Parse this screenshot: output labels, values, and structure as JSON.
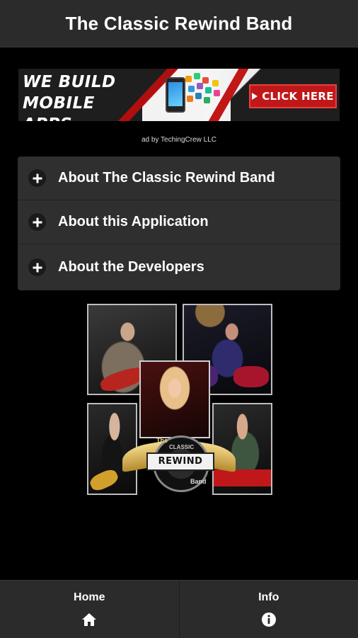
{
  "header": {
    "title": "The Classic Rewind Band"
  },
  "ad": {
    "headline_line1": "WE BUILD MOBILE",
    "headline_line2": "APPS.",
    "cta_label": "CLICK HERE",
    "credit": "ad by TechingCrew LLC"
  },
  "accordion": {
    "items": [
      {
        "label": "About The Classic Rewind Band",
        "icon": "plus-icon"
      },
      {
        "label": "About this Application",
        "icon": "plus-icon"
      },
      {
        "label": "About the Developers",
        "icon": "plus-icon"
      }
    ]
  },
  "collage": {
    "logo_the": "The",
    "logo_classic": "CLASSIC",
    "logo_word": "REWIND",
    "logo_band": "Band"
  },
  "footer": {
    "tabs": [
      {
        "label": "Home",
        "icon": "home-icon"
      },
      {
        "label": "Info",
        "icon": "info-icon"
      }
    ]
  }
}
